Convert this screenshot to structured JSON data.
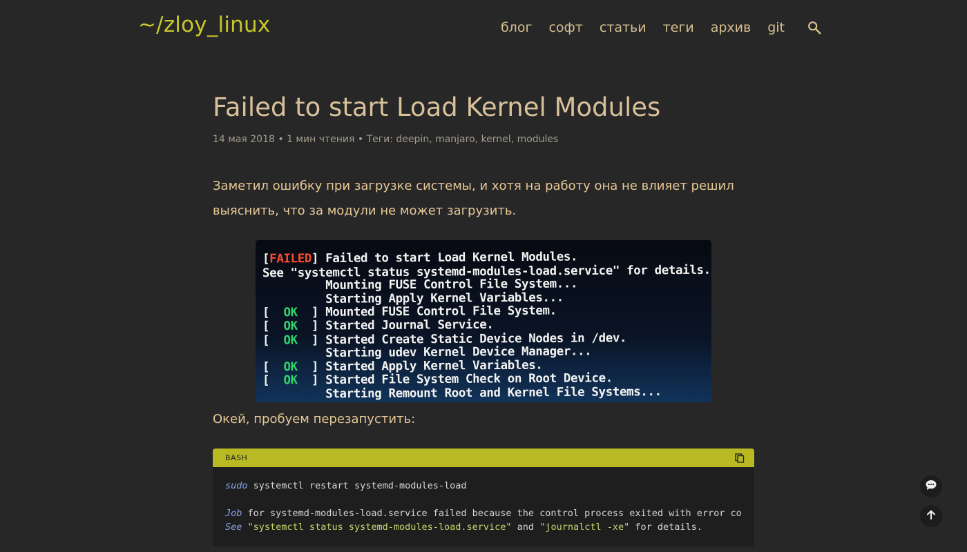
{
  "site": {
    "logo": "~/zloy_linux"
  },
  "nav": {
    "items": [
      "блог",
      "софт",
      "статьи",
      "теги",
      "архив",
      "git"
    ],
    "search_icon": "search-icon"
  },
  "post": {
    "title": "Failed to start Load Kernel Modules",
    "date": "14 мая 2018",
    "read_time": "1 мин чтения",
    "tags_label": "Теги:",
    "tags": [
      "deepin",
      "manjaro",
      "kernel",
      "modules"
    ],
    "paragraph1": "Заметил ошибку при загрузке системы, и хотя на работу она не влияет решил выяснить, что за модули не может загрузить.",
    "paragraph2": "Окей, пробуем перезапустить:"
  },
  "screenshot": {
    "lines": [
      {
        "pre": "[",
        "status": "FAILED",
        "post": "] Failed to start Load Kernel Modules."
      },
      {
        "pre": "See \"systemctl status systemd-modules-load.service\" for details.",
        "status": "",
        "post": ""
      },
      {
        "pre": "         Mounting FUSE Control File System...",
        "status": "",
        "post": ""
      },
      {
        "pre": "         Starting Apply Kernel Variables...",
        "status": "",
        "post": ""
      },
      {
        "pre": "[  ",
        "status": "OK",
        "post": "  ] Mounted FUSE Control File System."
      },
      {
        "pre": "[  ",
        "status": "OK",
        "post": "  ] Started Journal Service."
      },
      {
        "pre": "[  ",
        "status": "OK",
        "post": "  ] Started Create Static Device Nodes in /dev."
      },
      {
        "pre": "         Starting udev Kernel Device Manager...",
        "status": "",
        "post": ""
      },
      {
        "pre": "[  ",
        "status": "OK",
        "post": "  ] Started Apply Kernel Variables."
      },
      {
        "pre": "[  ",
        "status": "OK",
        "post": "  ] Started File System Check on Root Device."
      },
      {
        "pre": "         Starting Remount Root and Kernel File Systems...",
        "status": "",
        "post": ""
      }
    ]
  },
  "code": {
    "lang": "BASH",
    "copy_icon": "copy-icon",
    "line1_cmd": "sudo",
    "line1_rest": " systemctl restart systemd-modules-load",
    "line2_cmd": "Job",
    "line2_rest": " for systemd-modules-load.service failed because the control process exited with error code.",
    "line3_cmd": "See",
    "line3_str1": "\"systemctl status systemd-modules-load.service\"",
    "line3_mid": " and ",
    "line3_str2": "\"journalctl -xe\"",
    "line3_end": " for details."
  },
  "fabs": {
    "comments_icon": "comments-icon",
    "top_icon": "arrow-up-icon"
  },
  "colors": {
    "accent": "#b9b923",
    "background": "#272727",
    "text": "#e6c896"
  }
}
